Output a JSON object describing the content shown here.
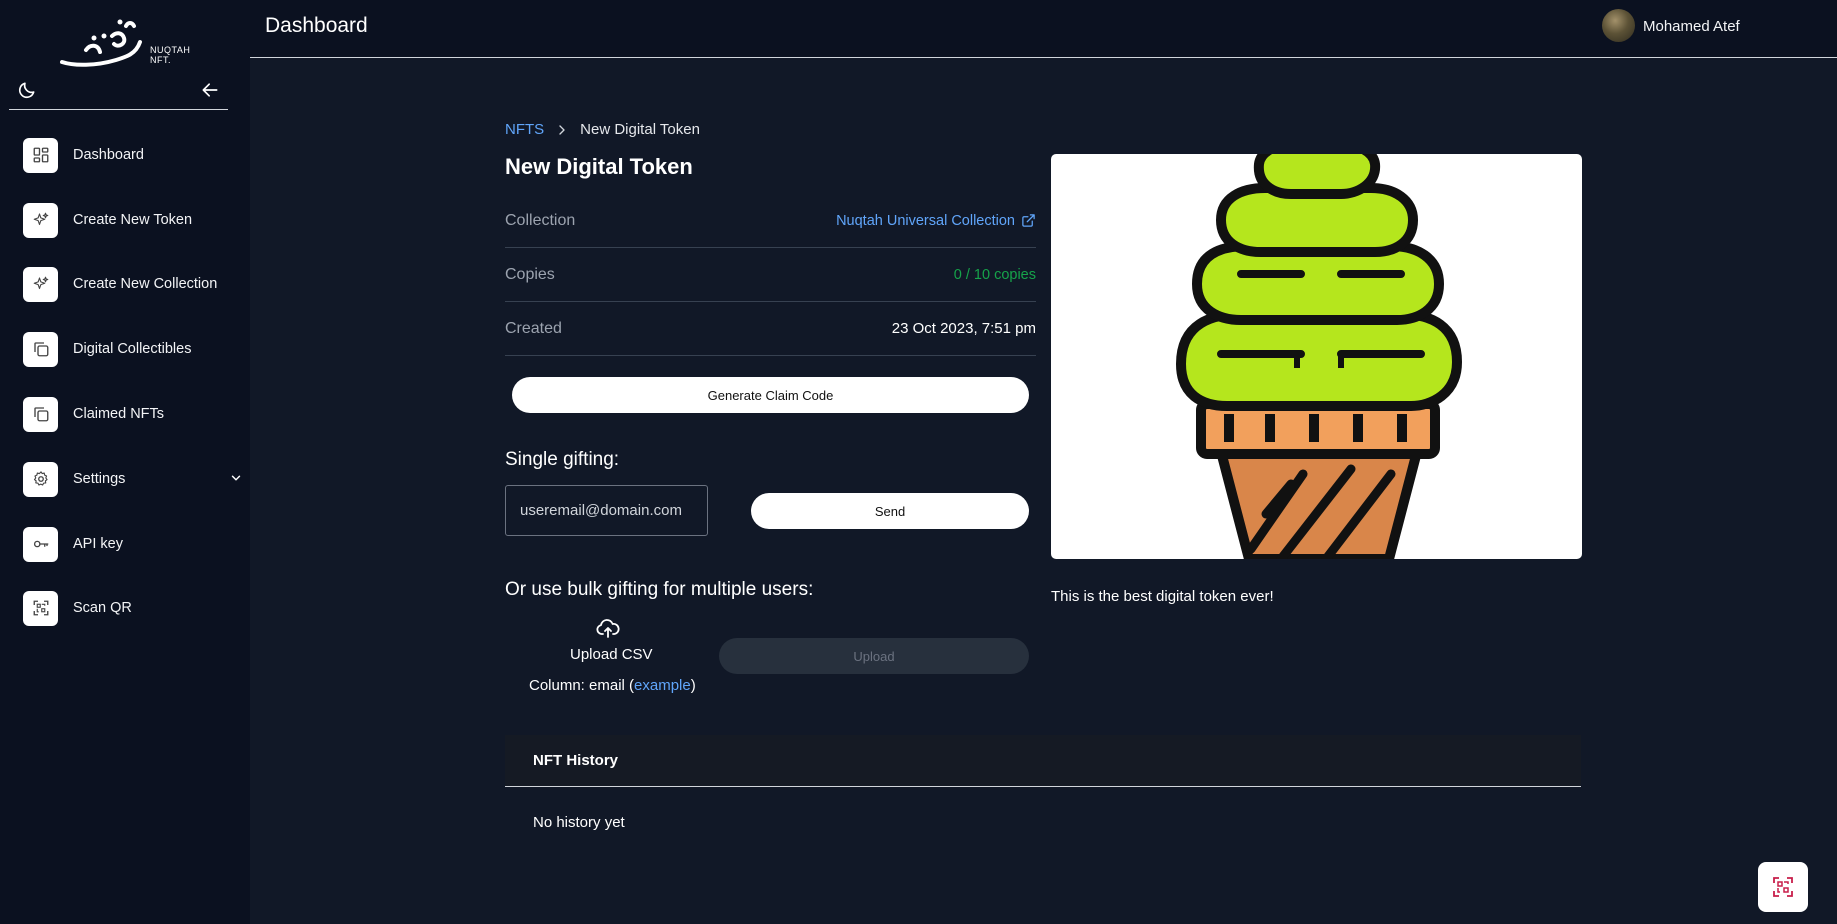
{
  "app": {
    "logo_text_line1": "NUQTAH",
    "logo_text_line2": "NFT."
  },
  "header": {
    "title": "Dashboard",
    "user_name": "Mohamed Atef"
  },
  "sidebar": {
    "items": [
      {
        "label": "Dashboard",
        "icon": "dashboard-icon"
      },
      {
        "label": "Create New Token",
        "icon": "sparkles-icon"
      },
      {
        "label": "Create New Collection",
        "icon": "sparkles-icon"
      },
      {
        "label": "Digital Collectibles",
        "icon": "copy-icon"
      },
      {
        "label": "Claimed NFTs",
        "icon": "copy-icon"
      },
      {
        "label": "Settings",
        "icon": "gear-icon"
      },
      {
        "label": "API key",
        "icon": "key-icon"
      },
      {
        "label": "Scan QR",
        "icon": "qr-icon"
      }
    ]
  },
  "breadcrumb": {
    "parent": "NFTS",
    "current": "New Digital Token"
  },
  "token": {
    "title": "New Digital Token",
    "collection_label": "Collection",
    "collection_value": "Nuqtah Universal Collection",
    "copies_label": "Copies",
    "copies_value": "0 / 10 copies",
    "created_label": "Created",
    "created_value": "23 Oct 2023, 7:51 pm",
    "description": "This is the best digital token ever!"
  },
  "actions": {
    "generate_label": "Generate Claim Code",
    "single_title": "Single gifting:",
    "email_placeholder": "useremail@domain.com",
    "send_label": "Send",
    "bulk_title": "Or use bulk gifting for multiple users:",
    "upload_csv_label": "Upload CSV",
    "column_prefix": "Column: email (",
    "column_link": "example",
    "column_suffix": ")",
    "upload_label": "Upload"
  },
  "history": {
    "title": "NFT History",
    "empty": "No history yet"
  },
  "colors": {
    "background": "#111827",
    "sidebar": "#0b1120",
    "accent_link": "#60a5fa",
    "copies_green": "#16a34a",
    "cream_lime": "#b5e61d",
    "cone_orange": "#f2a05c"
  }
}
